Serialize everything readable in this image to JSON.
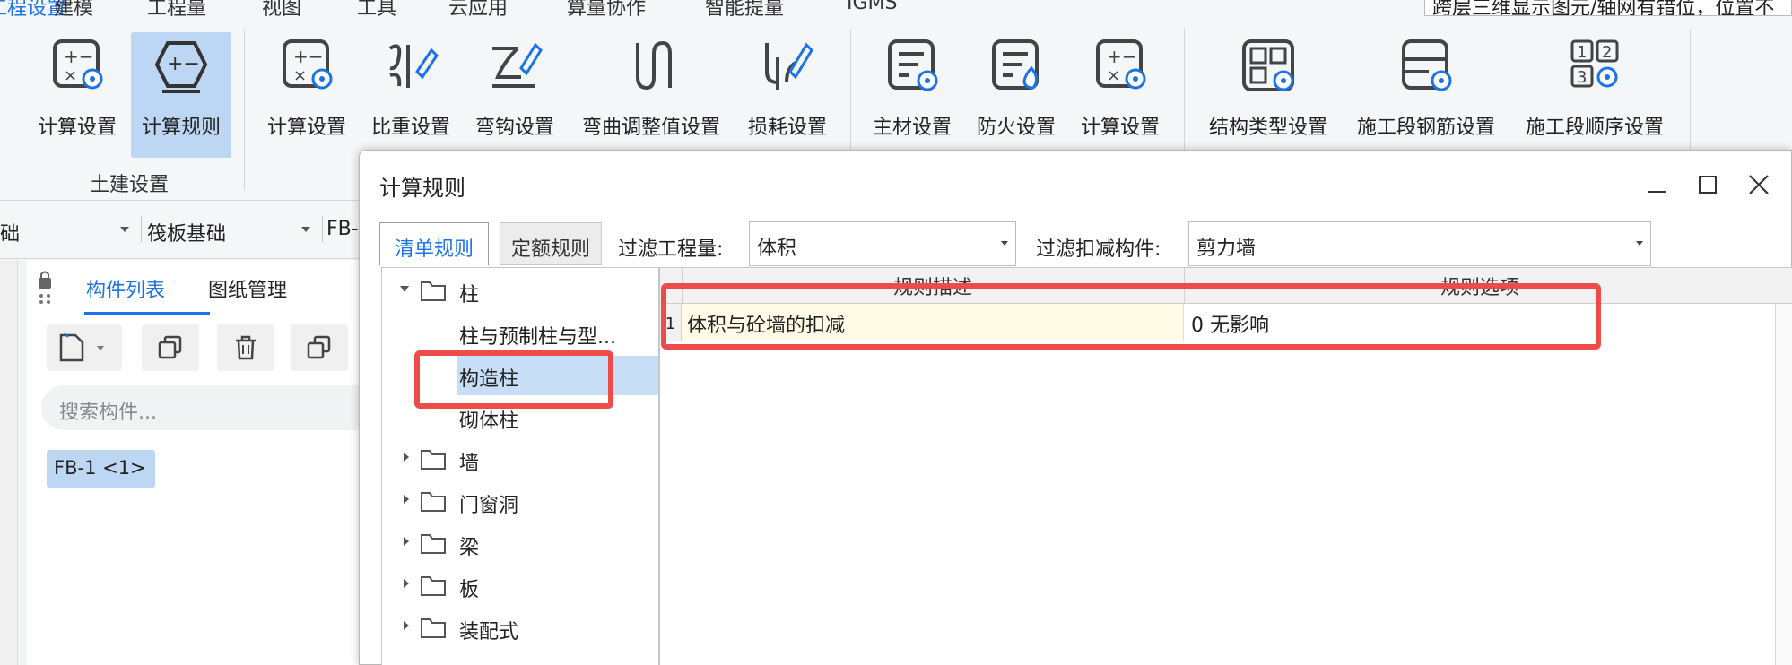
{
  "menu": {
    "items": [
      "工程设置",
      "建模",
      "工程量",
      "视图",
      "工具",
      "云应用",
      "算量协作",
      "智能提量",
      "IGMS"
    ],
    "active": 0,
    "notice": "跨层三维显示图元/轴网有错位，位置不"
  },
  "ribbon": {
    "group1": {
      "label": "土建设置",
      "buttons": [
        {
          "label": "计算设置",
          "icon": "calc-settings-icon"
        },
        {
          "label": "计算规则",
          "icon": "calc-rule-icon",
          "selected": true
        }
      ]
    },
    "group2": {
      "buttons": [
        {
          "label": "计算设置",
          "icon": "calc-settings-icon"
        },
        {
          "label": "比重设置",
          "icon": "density-settings-icon"
        },
        {
          "label": "弯钩设置",
          "icon": "hook-settings-icon"
        },
        {
          "label": "弯曲调整值设置",
          "icon": "bend-adjust-icon"
        },
        {
          "label": "损耗设置",
          "icon": "loss-settings-icon"
        }
      ]
    },
    "group3": {
      "buttons": [
        {
          "label": "主材设置",
          "icon": "main-material-icon"
        },
        {
          "label": "防火设置",
          "icon": "fire-settings-icon"
        },
        {
          "label": "计算设置",
          "icon": "calc-settings-icon"
        }
      ]
    },
    "group4": {
      "buttons": [
        {
          "label": "结构类型设置",
          "icon": "structure-type-icon"
        },
        {
          "label": "施工段钢筋设置",
          "icon": "segment-rebar-icon"
        },
        {
          "label": "施工段顺序设置",
          "icon": "segment-order-icon"
        }
      ]
    }
  },
  "toolbar": {
    "combo1": "础",
    "combo2": "筏板基础",
    "combo3": "FB-"
  },
  "panel": {
    "tab_components": "构件列表",
    "tab_drawings": "图纸管理",
    "search_placeholder": "搜索构件...",
    "component_tag": "FB-1 <1>"
  },
  "dialog": {
    "title": "计算规则",
    "tab_list": "清单规则",
    "tab_quota": "定额规则",
    "filter_qty_label": "过滤工程量:",
    "filter_qty_value": "体积",
    "filter_deduct_label": "过滤扣减构件:",
    "filter_deduct_value": "剪力墙",
    "tree": [
      {
        "label": "柱",
        "level": 0,
        "expanded": true
      },
      {
        "label": "柱与预制柱与型...",
        "level": 1
      },
      {
        "label": "构造柱",
        "level": 1,
        "selected": true
      },
      {
        "label": "砌体柱",
        "level": 1
      },
      {
        "label": "墙",
        "level": 0,
        "expanded": false
      },
      {
        "label": "门窗洞",
        "level": 0,
        "expanded": false
      },
      {
        "label": "梁",
        "level": 0,
        "expanded": false
      },
      {
        "label": "板",
        "level": 0,
        "expanded": false
      },
      {
        "label": "装配式",
        "level": 0,
        "expanded": false
      }
    ],
    "grid": {
      "col_desc": "规则描述",
      "col_option": "规则选项",
      "rows": [
        {
          "num": "1",
          "desc": "体积与砼墙的扣减",
          "option": "0   无影响"
        }
      ]
    }
  },
  "colors": {
    "accent": "#1a73e8",
    "selected_bg": "#bcd6f3",
    "highlight": "#ee4b4b",
    "cell_yellow": "#fffbe6"
  }
}
